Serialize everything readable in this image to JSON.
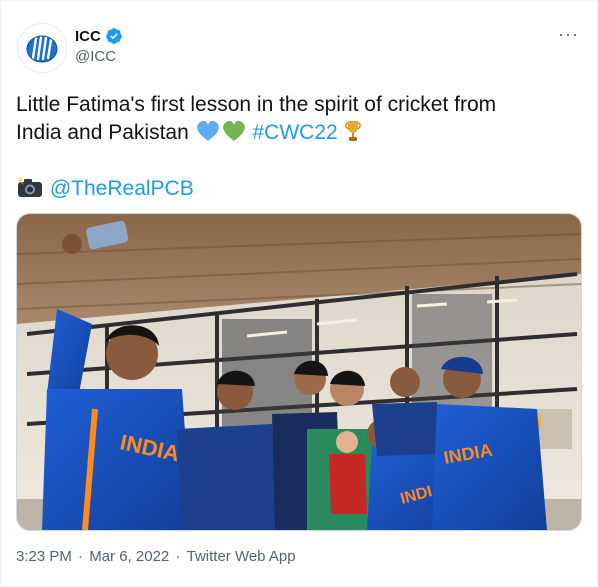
{
  "author": {
    "display_name": "ICC",
    "handle": "@ICC",
    "verified_icon": "verified-badge-icon",
    "avatar_icon": "icc-logo"
  },
  "tweet": {
    "line1_a": "Little Fatima's first lesson in the spirit of cricket from",
    "line1_b": "India and Pakistan",
    "hashtag": "#CWC22",
    "mention": "@TheRealPCB",
    "emojis": [
      "blue-heart-icon",
      "green-heart-icon",
      "trophy-icon",
      "camera-flash-icon"
    ]
  },
  "photo": {
    "jersey_text_1": "INDIA",
    "jersey_text_2": "INDIA",
    "jersey_text_3": "INDIA"
  },
  "footer": {
    "time": "3:23 PM",
    "sep1": " · ",
    "date": "Mar 6, 2022",
    "sep2": " · ",
    "app": "Twitter Web App"
  },
  "more_label": "···",
  "colors": {
    "link": "#1d9bf0",
    "secondary": "#536471",
    "india_blue": "#1a4fc4"
  }
}
